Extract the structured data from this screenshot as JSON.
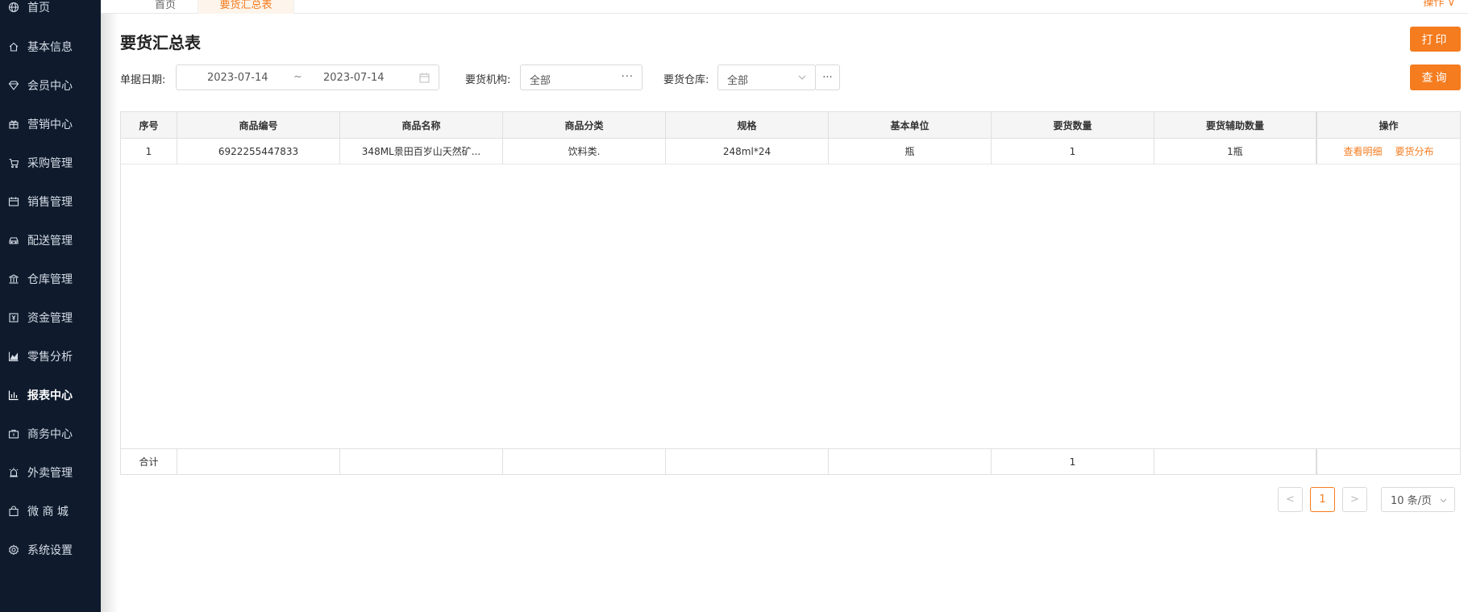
{
  "sidebar": {
    "items": [
      {
        "label": "首页",
        "icon": "globe-icon"
      },
      {
        "label": "基本信息",
        "icon": "home-icon"
      },
      {
        "label": "会员中心",
        "icon": "diamond-icon"
      },
      {
        "label": "营销中心",
        "icon": "gift-icon"
      },
      {
        "label": "采购管理",
        "icon": "cart-icon"
      },
      {
        "label": "销售管理",
        "icon": "calendar-icon"
      },
      {
        "label": "配送管理",
        "icon": "car-icon"
      },
      {
        "label": "仓库管理",
        "icon": "bank-icon"
      },
      {
        "label": "资金管理",
        "icon": "money-icon"
      },
      {
        "label": "零售分析",
        "icon": "area-chart-icon"
      },
      {
        "label": "报表中心",
        "icon": "bar-chart-icon"
      },
      {
        "label": "商务中心",
        "icon": "briefcase-icon"
      },
      {
        "label": "外卖管理",
        "icon": "alarm-icon"
      },
      {
        "label": "微 商 城",
        "icon": "shopping-bag-icon"
      },
      {
        "label": "系统设置",
        "icon": "gear-icon"
      }
    ],
    "active_index": 10
  },
  "tabs": {
    "home": "首页",
    "active": "要货汇总表",
    "operation": "操作 ∨"
  },
  "page": {
    "title": "要货汇总表",
    "print_button": "打印",
    "query_button": "查询"
  },
  "filters": {
    "date_label": "单据日期:",
    "date_start": "2023-07-14",
    "date_sep": "~",
    "date_end": "2023-07-14",
    "org_label": "要货机构:",
    "org_value": "全部",
    "warehouse_label": "要货仓库:",
    "warehouse_value": "全部",
    "more": "···"
  },
  "table": {
    "headers": [
      "序号",
      "商品编号",
      "商品名称",
      "商品分类",
      "规格",
      "基本单位",
      "要货数量",
      "要货辅助数量",
      "操作"
    ],
    "rows": [
      {
        "index": "1",
        "code": "6922255447833",
        "name": "348ML景田百岁山天然矿...",
        "category": "饮料类.",
        "spec": "248ml*24",
        "unit": "瓶",
        "qty": "1",
        "aux_qty": "1瓶",
        "actions": [
          "查看明细",
          "要货分布"
        ]
      }
    ],
    "footer": {
      "label": "合计",
      "qty_total": "1"
    }
  },
  "pagination": {
    "prev": "<",
    "current": "1",
    "next": ">",
    "page_size": "10 条/页"
  },
  "colors": {
    "accent": "#f57c1f",
    "sidebar_bg": "#0f1b2d"
  }
}
